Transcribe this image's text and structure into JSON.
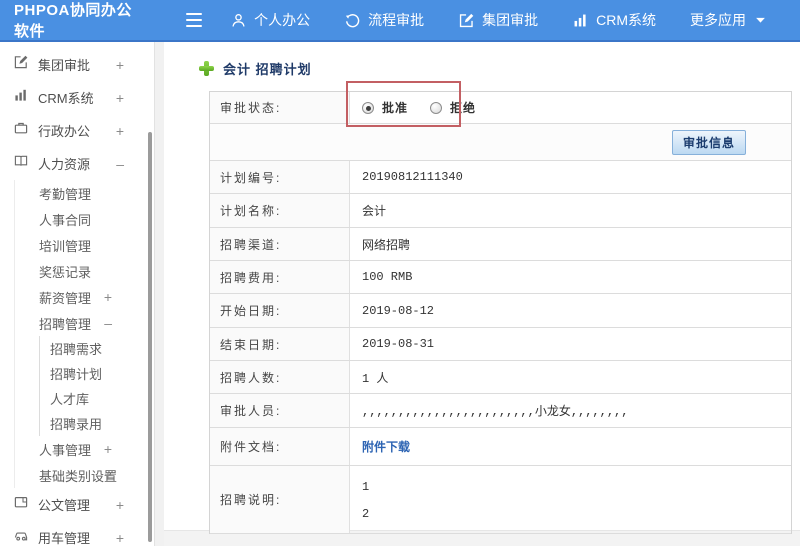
{
  "topbar": {
    "brand": "PHPOA协同办公软件",
    "items": [
      {
        "label": "个人办公",
        "icon": "person-icon"
      },
      {
        "label": "流程审批",
        "icon": "flow-refresh-icon"
      },
      {
        "label": "集团审批",
        "icon": "edit-square-icon"
      },
      {
        "label": "CRM系统",
        "icon": "bar-chart-icon"
      },
      {
        "label": "更多应用",
        "icon": "caret-down-icon"
      }
    ]
  },
  "sidebar": {
    "items": [
      {
        "label": "集团审批",
        "suffix": "+"
      },
      {
        "label": "CRM系统",
        "suffix": "+"
      },
      {
        "label": "行政办公",
        "suffix": "+"
      },
      {
        "label": "人力资源",
        "suffix": "–"
      },
      {
        "label": "考勤管理",
        "suffix": ""
      },
      {
        "label": "人事合同",
        "suffix": ""
      },
      {
        "label": "培训管理",
        "suffix": ""
      },
      {
        "label": "奖惩记录",
        "suffix": ""
      },
      {
        "label": "薪资管理",
        "suffix": "+"
      },
      {
        "label": "招聘管理",
        "suffix": "–"
      },
      {
        "label": "招聘需求",
        "suffix": ""
      },
      {
        "label": "招聘计划",
        "suffix": ""
      },
      {
        "label": "人才库",
        "suffix": ""
      },
      {
        "label": "招聘录用",
        "suffix": ""
      },
      {
        "label": "人事管理",
        "suffix": "+"
      },
      {
        "label": "基础类别设置",
        "suffix": "+"
      },
      {
        "label": "公文管理",
        "suffix": "+"
      },
      {
        "label": "用车管理",
        "suffix": "+"
      }
    ]
  },
  "main": {
    "title": "会计 招聘计划",
    "status_row": {
      "label": "审批状态:",
      "options": [
        {
          "label": "批准",
          "selected": true
        },
        {
          "label": "拒绝",
          "selected": false
        }
      ]
    },
    "approve_button": "审批信息",
    "rows": [
      {
        "label": "计划编号:",
        "value": "20190812111340"
      },
      {
        "label": "计划名称:",
        "value": "会计"
      },
      {
        "label": "招聘渠道:",
        "value": "网络招聘"
      },
      {
        "label": "招聘费用:",
        "value": "100 RMB"
      },
      {
        "label": "开始日期:",
        "value": "2019-08-12"
      },
      {
        "label": "结束日期:",
        "value": "2019-08-31"
      },
      {
        "label": "招聘人数:",
        "value": "1 人"
      },
      {
        "label": "审批人员:",
        "value": ",,,,,,,,,,,,,,,,,,,,,,,,小龙女,,,,,,,,"
      },
      {
        "label": "附件文档:",
        "value": "附件下载"
      },
      {
        "label": "招聘说明:",
        "value": "1\n2"
      }
    ],
    "colors": {
      "topbar_blue": "#4a90e2",
      "highlight_red": "#c35f63",
      "link_blue": "#2d64b3",
      "title_navy": "#1f3a68",
      "plus_green": "#6cbe35"
    }
  }
}
